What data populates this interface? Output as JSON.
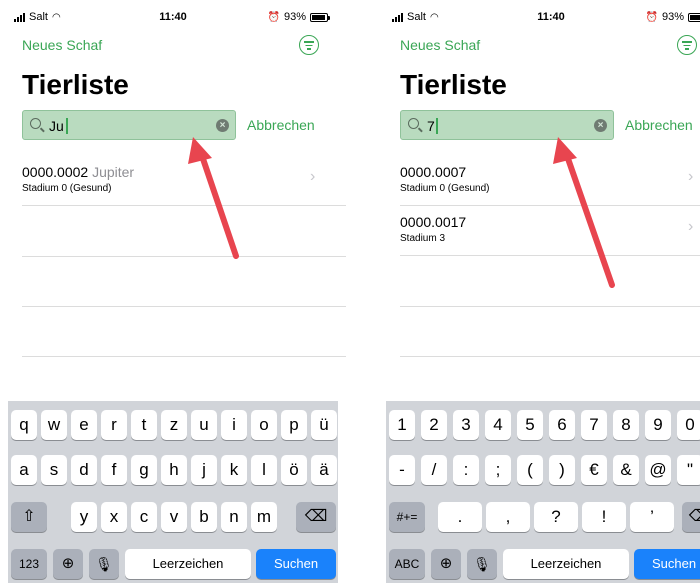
{
  "status": {
    "carrier": "Salt",
    "time": "11:40",
    "battery": "93%"
  },
  "nav": {
    "left": "Neues Schaf",
    "filter_icon": "filter-circle-icon"
  },
  "title": "Tierliste",
  "cancel": "Abbrechen",
  "colors": {
    "accent": "#3aa655",
    "search_bg": "#b9dbbf",
    "arrow": "#e8454f",
    "key_blue": "#1a82fb"
  },
  "left": {
    "search": {
      "value": "Ju"
    },
    "results": [
      {
        "id": "0000.0002",
        "name": "Jupiter",
        "status": "Stadium 0 (Gesund)"
      }
    ],
    "keyboard": {
      "row1": [
        "q",
        "w",
        "e",
        "r",
        "t",
        "z",
        "u",
        "i",
        "o",
        "p",
        "ü"
      ],
      "row2": [
        "a",
        "s",
        "d",
        "f",
        "g",
        "h",
        "j",
        "k",
        "l",
        "ö",
        "ä"
      ],
      "row3": [
        "y",
        "x",
        "c",
        "v",
        "b",
        "n",
        "m"
      ],
      "bottom": {
        "mode": "123",
        "space": "Leerzeichen",
        "return": "Suchen"
      }
    }
  },
  "right": {
    "search": {
      "value": "7"
    },
    "results": [
      {
        "id": "0000.0007",
        "name": "",
        "status": "Stadium 0 (Gesund)"
      },
      {
        "id": "0000.0017",
        "name": "",
        "status": "Stadium 3"
      }
    ],
    "keyboard": {
      "row1": [
        "1",
        "2",
        "3",
        "4",
        "5",
        "6",
        "7",
        "8",
        "9",
        "0"
      ],
      "row2": [
        "-",
        "/",
        ":",
        ";",
        "(",
        ")",
        "€",
        "&",
        "@",
        "\""
      ],
      "row3": [
        ".",
        ",",
        "?",
        "!",
        "’"
      ],
      "bottom": {
        "symbols": "#+=",
        "mode": "ABC",
        "space": "Leerzeichen",
        "return": "Suchen"
      }
    }
  }
}
